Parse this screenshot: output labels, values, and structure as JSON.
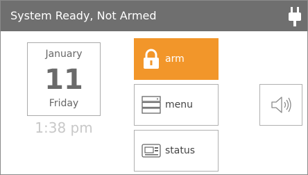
{
  "header": {
    "status_text": "System Ready, Not Armed",
    "power_icon": "plug-icon"
  },
  "calendar": {
    "month": "January",
    "day": "11",
    "weekday": "Friday",
    "time": "1:38 pm"
  },
  "buttons": {
    "arm": {
      "label": "arm",
      "icon": "lock-icon"
    },
    "menu": {
      "label": "menu",
      "icon": "menu-icon"
    },
    "status": {
      "label": "status",
      "icon": "status-panel-icon"
    }
  },
  "speaker": {
    "icon": "speaker-icon"
  },
  "colors": {
    "header_bg": "#6f6f6f",
    "accent": "#f2962a",
    "text_gray": "#666666",
    "time_gray": "#c8c8c8"
  }
}
